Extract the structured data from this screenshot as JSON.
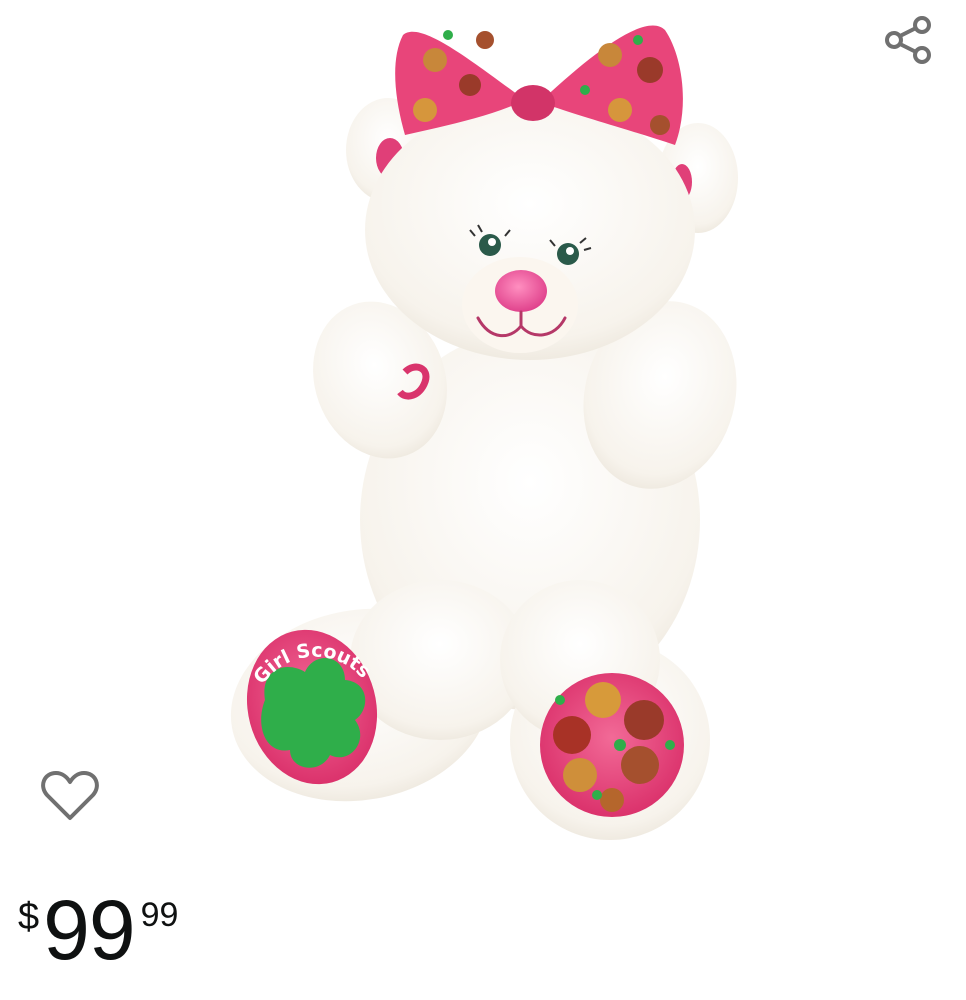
{
  "product": {
    "image_alt": "Girl Scouts plush teddy bear",
    "foot_logo_text": "Girl Scouts"
  },
  "actions": {
    "share_icon": "share-icon",
    "wishlist_icon": "heart-outline-icon"
  },
  "price": {
    "symbol": "$",
    "whole": "99",
    "fraction": "99"
  },
  "colors": {
    "text": "#0f1111",
    "icon": "#707070",
    "bow_pink": "#e8457a",
    "paw_pink": "#e83f78",
    "trefoil_green": "#2fae4a",
    "fur_white": "#fbf8f3"
  }
}
